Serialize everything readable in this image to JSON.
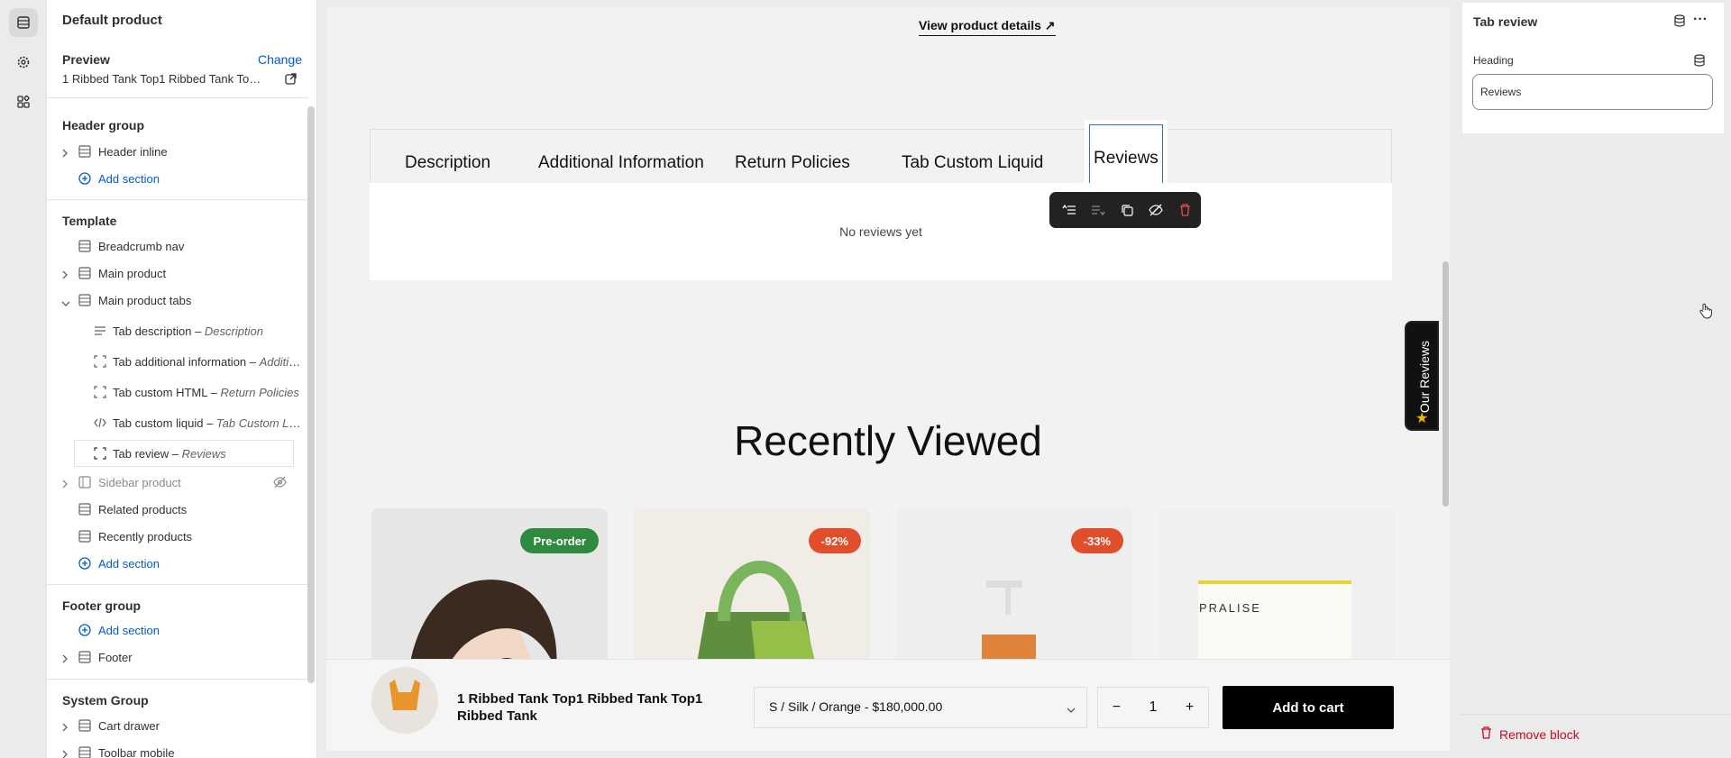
{
  "rail": {
    "icons": [
      "sections-icon",
      "gear-icon",
      "apps-icon"
    ]
  },
  "left_panel": {
    "title": "Default product",
    "preview_label": "Preview",
    "change_label": "Change",
    "preview_product": "1 Ribbed Tank Top1 Ribbed Tank Top1 Ribbed Tank",
    "header_group": {
      "title": "Header group",
      "items": [
        "Header inline"
      ],
      "add_section": "Add section"
    },
    "template": {
      "title": "Template",
      "items": [
        "Breadcrumb nav",
        "Main product",
        "Main product tabs"
      ],
      "blocks": [
        {
          "label": "Tab description",
          "sub": "Description"
        },
        {
          "label": "Tab additional information",
          "sub": "Additional Information"
        },
        {
          "label": "Tab custom HTML",
          "sub": "Return Policies"
        },
        {
          "label": "Tab custom liquid",
          "sub": "Tab Custom Liquid"
        },
        {
          "label": "Tab review",
          "sub": "Reviews"
        }
      ],
      "after": [
        "Sidebar product",
        "Related products",
        "Recently products"
      ],
      "add_section": "Add section"
    },
    "footer_group": {
      "title": "Footer group",
      "add_section": "Add section",
      "items": [
        "Footer"
      ]
    },
    "system_group": {
      "title": "System Group",
      "items": [
        "Cart drawer",
        "Toolbar mobile"
      ]
    }
  },
  "preview": {
    "view_details": "View product details",
    "tabs": [
      "Description",
      "Additional Information",
      "Return Policies",
      "Tab Custom Liquid",
      "Reviews"
    ],
    "no_reviews": "No reviews yet",
    "recently_viewed": "Recently Viewed",
    "our_reviews": "Our Reviews",
    "badges": [
      "Pre-order",
      "-92%",
      "-33%"
    ],
    "card4_brand": "PRALISE",
    "sticky": {
      "product_name": "1 Ribbed Tank Top1 Ribbed Tank Top1 Ribbed Tank",
      "variant": "S / Silk / Orange - $180,000.00",
      "qty": "1",
      "add_to_cart": "Add to cart"
    }
  },
  "right_panel": {
    "title": "Tab review",
    "heading_label": "Heading",
    "heading_value": "Reviews",
    "remove_block": "Remove block"
  },
  "colors": {
    "accent": "#005bd3",
    "danger": "#c70a24",
    "badge_green": "#2e8a3e",
    "badge_red": "#e04e2c"
  }
}
